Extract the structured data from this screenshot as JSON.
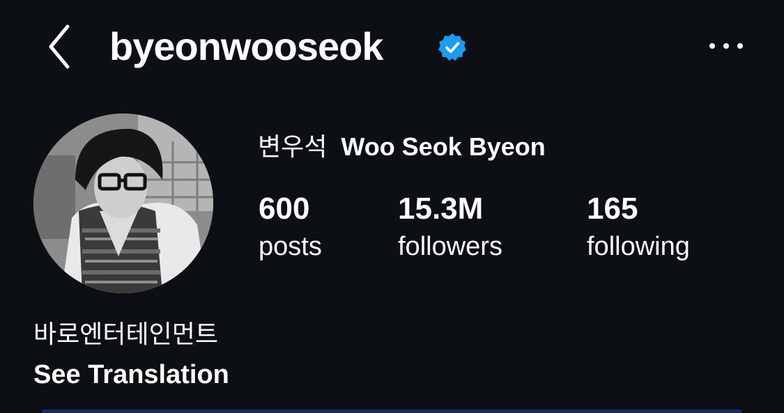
{
  "header": {
    "username": "byeonwooseok",
    "verified": true,
    "verified_color": "#1d9bf0",
    "back_icon": "chevron-left-icon",
    "more_icon": "more-horizontal-icon"
  },
  "profile": {
    "name_korean": "변우석",
    "name_english": "Woo Seok Byeon",
    "avatar_icon": "profile-photo"
  },
  "stats": {
    "posts": {
      "value": "600",
      "label": "posts"
    },
    "followers": {
      "value": "15.3M",
      "label": "followers"
    },
    "following": {
      "value": "165",
      "label": "following"
    }
  },
  "bio": {
    "text": "바로엔터테인먼트",
    "translate_label": "See Translation"
  },
  "colors": {
    "background": "#0c0f14",
    "text": "#ffffff",
    "accent": "#1d9bf0"
  }
}
